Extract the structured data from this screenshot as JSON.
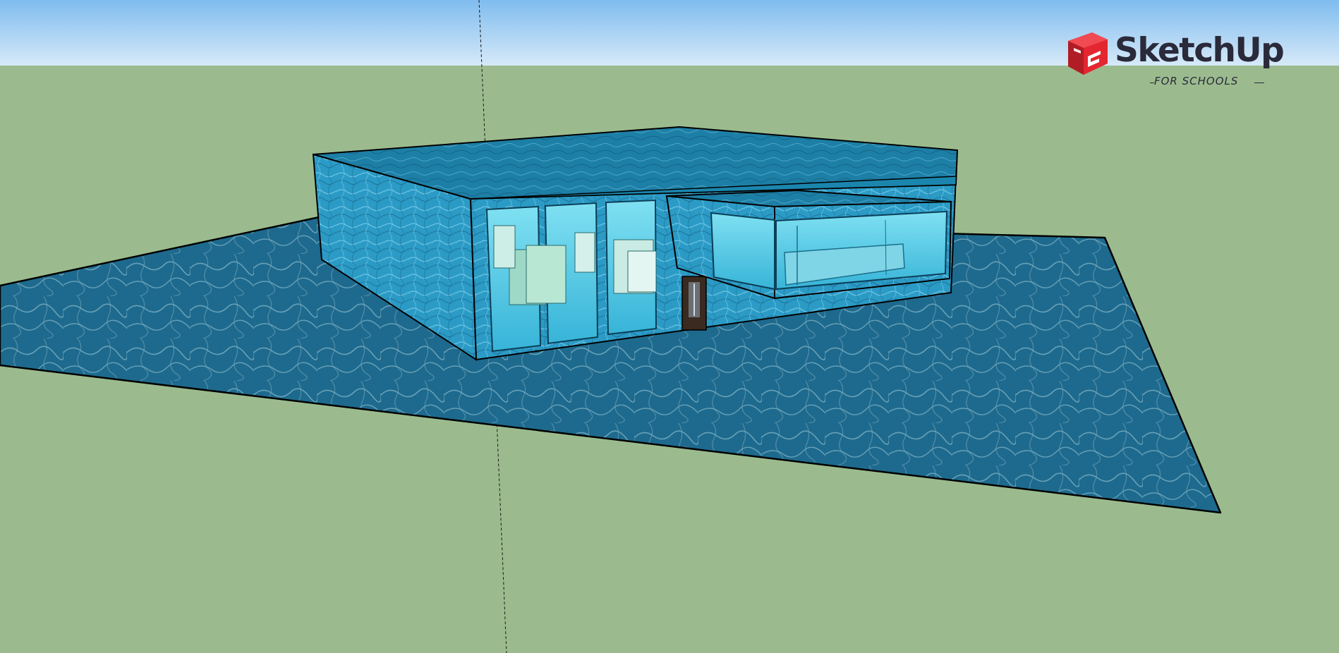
{
  "app": {
    "brand_name": "SketchUp",
    "brand_subtitle": "FOR SCHOOLS",
    "brand_color": "#e3262f"
  },
  "viewport": {
    "sky_color_top": "#7fbcef",
    "sky_color_bottom": "#d6e9f8",
    "ground_color": "#9bbb8e",
    "material_water": "#1e6f96",
    "material_building": "#2a9cc8",
    "material_glass": "#5fd1ea",
    "door_color": "#3a2a20"
  },
  "icons": {
    "logo": "sketchup-logo-icon"
  }
}
